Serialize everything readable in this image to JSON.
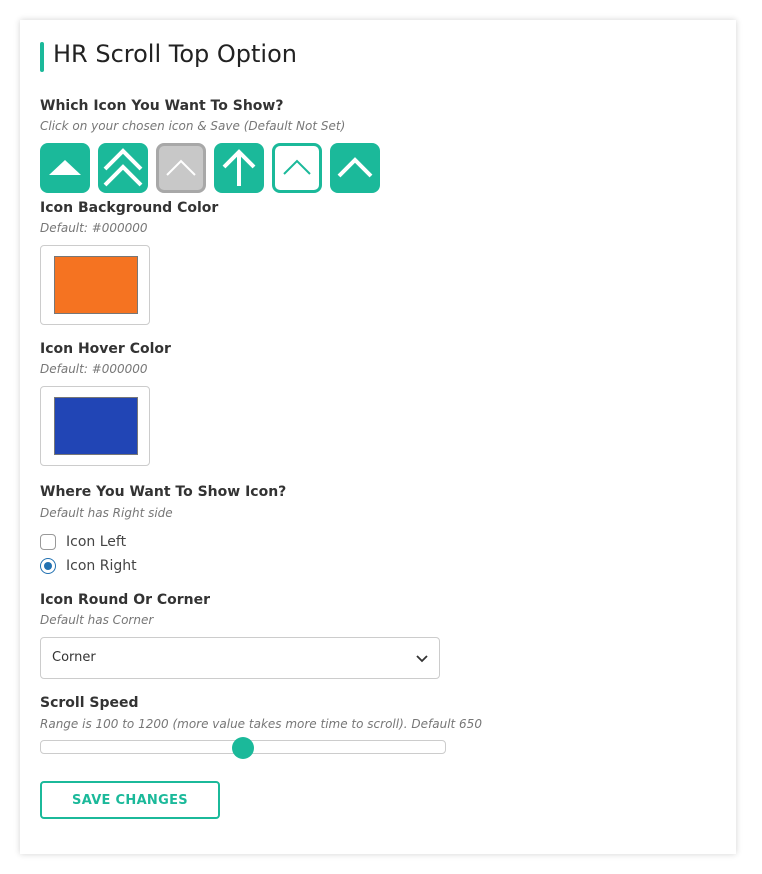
{
  "page": {
    "title": "HR Scroll Top Option"
  },
  "icon_section": {
    "label": "Which Icon You Want To Show?",
    "hint": "Click on your chosen icon & Save (Default Not Set)",
    "icons": [
      {
        "name": "triangle-up-icon",
        "style": "filled",
        "selected": false
      },
      {
        "name": "double-chevron-up-icon",
        "style": "filled",
        "selected": false
      },
      {
        "name": "chevron-up-icon",
        "style": "grey",
        "selected": true
      },
      {
        "name": "arrow-up-icon",
        "style": "filled",
        "selected": false
      },
      {
        "name": "chevron-up-thin-icon",
        "style": "outline",
        "selected": false
      },
      {
        "name": "chevron-up-bold-icon",
        "style": "filled",
        "selected": false
      }
    ]
  },
  "bg_color": {
    "label": "Icon Background Color",
    "hint": "Default: #000000",
    "value": "#f57321"
  },
  "hover_color": {
    "label": "Icon Hover Color",
    "hint": "Default: #000000",
    "value": "#2145b5"
  },
  "position": {
    "label": "Where You Want To Show Icon?",
    "hint": "Default has Right side",
    "options": [
      {
        "label": "Icon Left",
        "checked": false
      },
      {
        "label": "Icon Right",
        "checked": true
      }
    ]
  },
  "shape": {
    "label": "Icon Round Or Corner",
    "hint": "Default has Corner",
    "selected": "Corner"
  },
  "speed": {
    "label": "Scroll Speed",
    "hint": "Range is 100 to 1200 (more value takes more time to scroll). Default 650",
    "min": 100,
    "max": 1200,
    "value": 650
  },
  "actions": {
    "save_label": "SAVE CHANGES"
  },
  "colors": {
    "accent": "#1bb99a",
    "radio_accent": "#2271b1"
  }
}
